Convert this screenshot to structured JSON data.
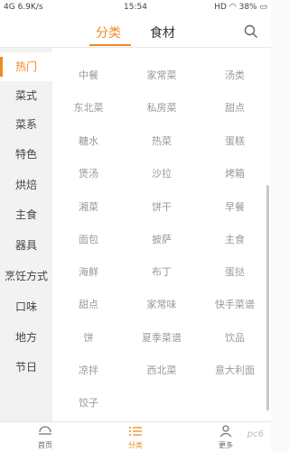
{
  "status_bar": {
    "signal": "4G",
    "speed": "6.9K/s",
    "time": "15:54",
    "hd": "HD",
    "battery": "38%"
  },
  "header": {
    "tabs": [
      {
        "label": "分类"
      },
      {
        "label": "食材"
      }
    ],
    "search_icon": "search-icon"
  },
  "sidebar": {
    "items": [
      {
        "label": "热门",
        "active": true
      },
      {
        "label": "菜式"
      },
      {
        "label": "菜系"
      },
      {
        "label": "特色"
      },
      {
        "label": "烘焙"
      },
      {
        "label": "主食"
      },
      {
        "label": "器具"
      },
      {
        "label": "烹饪方式"
      },
      {
        "label": "口味"
      },
      {
        "label": "地方"
      },
      {
        "label": "节日"
      }
    ]
  },
  "categories": [
    "中餐",
    "家常菜",
    "汤类",
    "东北菜",
    "私房菜",
    "甜点",
    "糖水",
    "热菜",
    "蛋糕",
    "煲汤",
    "沙拉",
    "烤箱",
    "湘菜",
    "饼干",
    "早餐",
    "面包",
    "披萨",
    "主食",
    "海鲜",
    "布丁",
    "蛋挞",
    "甜点",
    "家常味",
    "快手菜谱",
    "饼",
    "夏季菜谱",
    "饮品",
    "凉拌",
    "西北菜",
    "意大利面",
    "饺子"
  ],
  "bottom_nav": [
    {
      "label": "首页",
      "icon": "home-icon"
    },
    {
      "label": "分类",
      "icon": "list-icon",
      "active": true
    },
    {
      "label": "更多",
      "icon": "user-icon"
    }
  ],
  "watermark": "pc6"
}
